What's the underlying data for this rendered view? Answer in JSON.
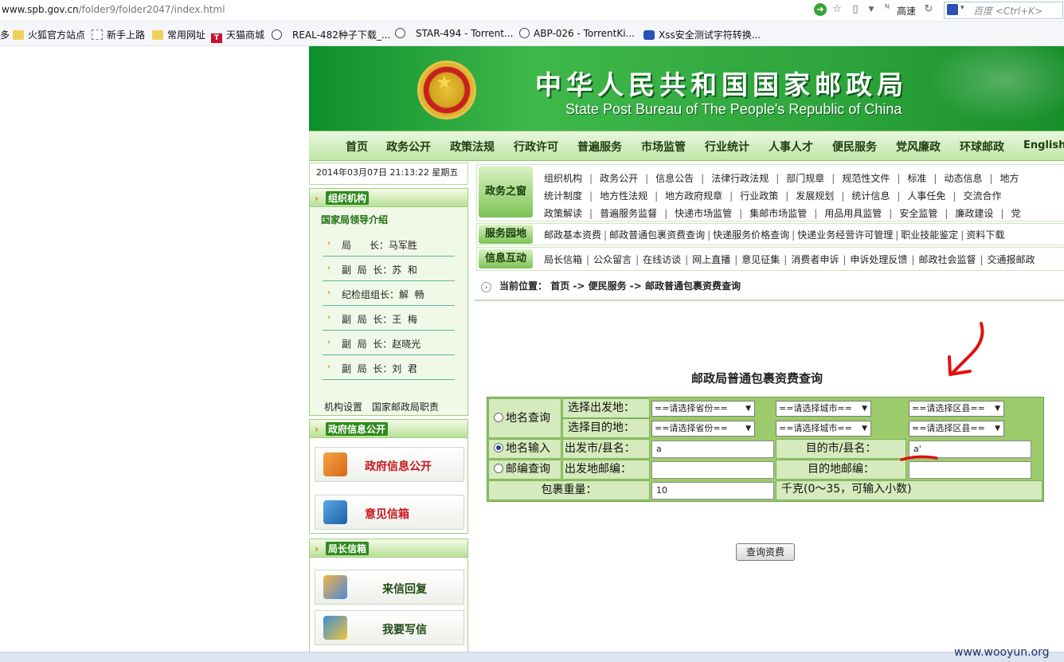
{
  "browser": {
    "url_host": "www.spb.gov.cn",
    "url_path": "/folder9/folder2047/index.html",
    "speed_label": "高速",
    "search_placeholder": "百度 <Ctrl+K>",
    "bookmarks": [
      "多",
      "火狐官方站点",
      "新手上路",
      "常用网址",
      "天猫商城",
      "REAL-482种子下载_...",
      "STAR-494 - Torrent...",
      "ABP-026 - TorrentKi...",
      "Xss安全测试字符转换..."
    ]
  },
  "site": {
    "title": "中华人民共和国国家邮政局",
    "subtitle": "State Post Bureau of The People's Republic of China",
    "nav": [
      "首页",
      "政务公开",
      "政策法规",
      "行政许可",
      "普遍服务",
      "市场监管",
      "行业统计",
      "人事人才",
      "便民服务",
      "党风廉政",
      "环球邮政",
      "English"
    ]
  },
  "sidebar": {
    "date": "2014年03月07日 21:13:22 星期五",
    "org": {
      "heading": "组织机构",
      "leaders_title": "国家局领导介绍",
      "leaders": [
        "局      长：马军胜",
        "副  局  长：苏  和",
        "纪检组组长：解  畅",
        "副  局  长：王  梅",
        "副  局  长：赵晓光",
        "副  局  长：刘  君"
      ],
      "links": [
        "机构设置",
        "国家邮政局职责"
      ]
    },
    "gov_info": {
      "heading": "政府信息公开",
      "buttons": [
        "政府信息公开",
        "意见信箱"
      ]
    },
    "director_mail": {
      "heading": "局长信箱",
      "buttons": [
        "来信回复",
        "我要写信"
      ]
    }
  },
  "quick": {
    "gov_window": {
      "tag": "政务之窗",
      "rows": [
        [
          "组织机构",
          "政务公开",
          "信息公告",
          "法律行政法规",
          "部门规章",
          "规范性文件",
          "标准",
          "动态信息",
          "地方"
        ],
        [
          "统计制度",
          "地方性法规",
          "地方政府规章",
          "行业政策",
          "发展规划",
          "统计信息",
          "人事任免",
          "交流合作"
        ],
        [
          "政策解读",
          "普遍服务监督",
          "快递市场监管",
          "集邮市场监管",
          "用品用具监管",
          "安全监管",
          "廉政建设",
          "党"
        ]
      ]
    },
    "service": {
      "tag": "服务园地",
      "items": [
        "邮政基本资费",
        "邮政普通包裹资费查询",
        "快递服务价格查询",
        "快递业务经营许可管理",
        "职业技能鉴定",
        "资料下载"
      ]
    },
    "interact": {
      "tag": "信息互动",
      "items": [
        "局长信箱",
        "公众留言",
        "在线访谈",
        "网上直播",
        "意见征集",
        "消费者申诉",
        "申诉处理反馈",
        "邮政社会监督",
        "交通报邮政"
      ]
    }
  },
  "breadcrumb": {
    "label": "当前位置：",
    "items": [
      "首页",
      "便民服务",
      "邮政普通包裹资费查询"
    ],
    "sep": " -> "
  },
  "form": {
    "title": "邮政局普通包裹资费查询",
    "modes": [
      "地名查询",
      "地名输入",
      "邮编查询"
    ],
    "selected_mode": "地名输入",
    "labels": {
      "from_select": "选择出发地：",
      "to_select": "选择目的地：",
      "from_city": "出发市/县名：",
      "to_city": "目的市/县名：",
      "from_zip": "出发地邮编：",
      "to_zip": "目的地邮编：",
      "weight": "包裹重量：",
      "weight_hint": "千克(0～35，可输入小数)"
    },
    "selects": {
      "province": "==请选择省份==",
      "city": "==请选择城市==",
      "county": "==请选择区县=="
    },
    "values": {
      "from_city": "a",
      "to_city": "a'",
      "from_zip": "",
      "to_zip": "",
      "weight": "10"
    },
    "submit": "查询资费"
  },
  "watermark": "www.wooyun.org",
  "colors": {
    "banner_green": "#2ea43c",
    "annotation_red": "#e01010",
    "radio_blue": "#1e3f9e"
  }
}
